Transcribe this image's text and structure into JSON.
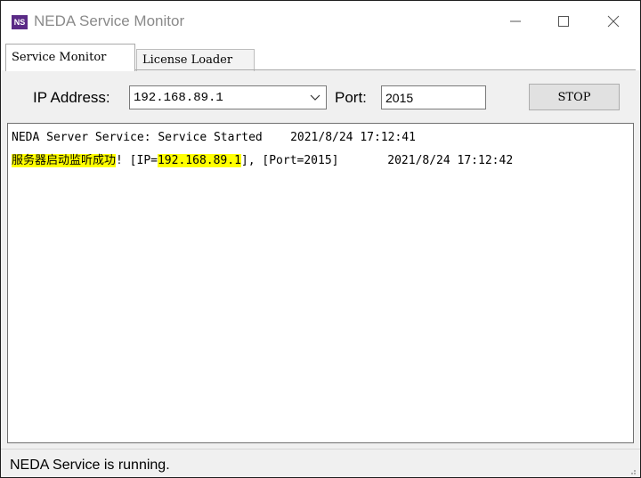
{
  "window": {
    "title": "NEDA Service Monitor",
    "icon_text": "NS"
  },
  "tabs": [
    {
      "label": "Service Monitor",
      "active": true
    },
    {
      "label": "License Loader",
      "active": false
    }
  ],
  "form": {
    "ip_label": "IP Address:",
    "ip_value": "192.168.89.1",
    "port_label": "Port:",
    "port_value": "2015",
    "stop_label": "STOP"
  },
  "log": {
    "line1": "NEDA Server Service: Service Started    2021/8/24 17:12:41",
    "line2": {
      "msg": "服务器启动监听成功",
      "p1": "! [IP=",
      "ip": "192.168.89.1",
      "p2": "], [Port=2015]       2021/8/24 17:12:42"
    }
  },
  "status": {
    "text": "NEDA Service is running."
  },
  "colors": {
    "highlight": "#ffff00",
    "icon_bg": "#5a2a86"
  }
}
